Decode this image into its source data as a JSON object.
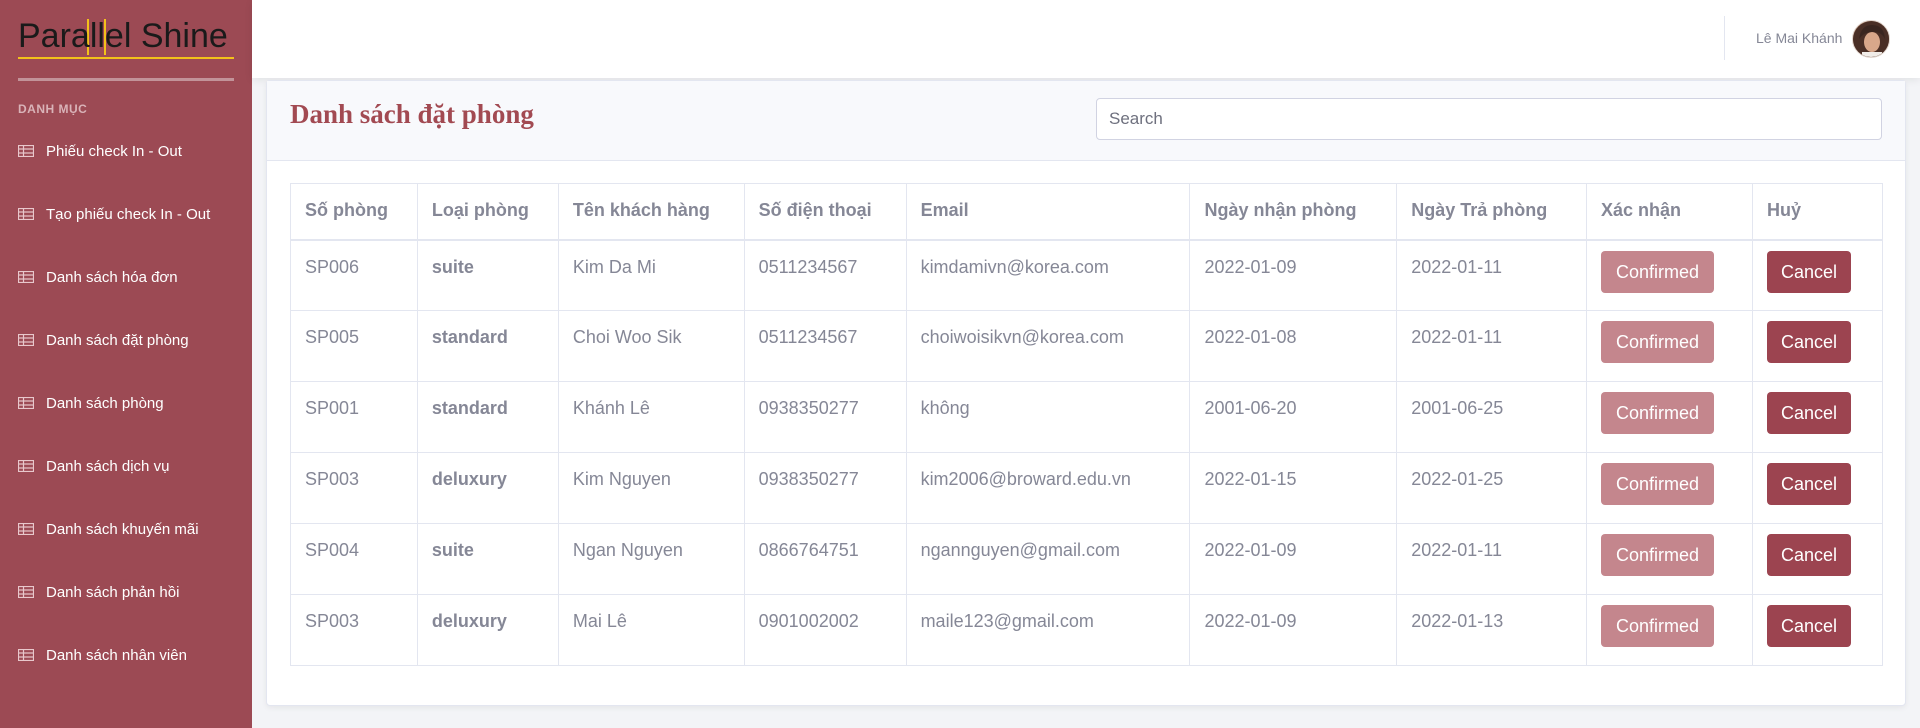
{
  "app": {
    "logo_text": "Parallel Shine",
    "colors": {
      "sidebar": "#9c4a54",
      "accent_title": "#a24a52",
      "logo_accent": "#f3c11a",
      "confirmed_button": "#c4868d",
      "cancel_button": "#9c4450"
    }
  },
  "sidebar": {
    "heading": "DANH MỤC",
    "items": [
      {
        "label": "Phiếu check In - Out",
        "icon": "table-icon"
      },
      {
        "label": "Tạo phiếu check In - Out",
        "icon": "table-icon"
      },
      {
        "label": "Danh sách hóa đơn",
        "icon": "table-icon"
      },
      {
        "label": "Danh sách đặt phòng",
        "icon": "table-icon"
      },
      {
        "label": "Danh sách phòng",
        "icon": "table-icon"
      },
      {
        "label": "Danh sách dịch vụ",
        "icon": "table-icon"
      },
      {
        "label": "Danh sách khuyến mãi",
        "icon": "table-icon"
      },
      {
        "label": "Danh sách phản hồi",
        "icon": "table-icon"
      },
      {
        "label": "Danh sách nhân viên",
        "icon": "table-icon"
      }
    ]
  },
  "topbar": {
    "user_name": "Lê Mai Khánh"
  },
  "main": {
    "title": "Danh sách đặt phòng",
    "search_placeholder": "Search",
    "table": {
      "headers": [
        "Số phòng",
        "Loại phòng",
        "Tên khách hàng",
        "Số điện thoại",
        "Email",
        "Ngày nhận phòng",
        "Ngày Trả phòng",
        "Xác nhận",
        "Huỷ"
      ],
      "rows": [
        {
          "room": "SP006",
          "type": "suite",
          "customer": "Kim Da Mi",
          "phone": "0511234567",
          "email": "kimdamivn@korea.com",
          "checkin": "2022-01-09",
          "checkout": "2022-01-11",
          "confirm": "Confirmed",
          "cancel": "Cancel"
        },
        {
          "room": "SP005",
          "type": "standard",
          "customer": "Choi Woo Sik",
          "phone": "0511234567",
          "email": "choiwoisikvn@korea.com",
          "checkin": "2022-01-08",
          "checkout": "2022-01-11",
          "confirm": "Confirmed",
          "cancel": "Cancel"
        },
        {
          "room": "SP001",
          "type": "standard",
          "customer": "Khánh Lê",
          "phone": "0938350277",
          "email": "không",
          "checkin": "2001-06-20",
          "checkout": "2001-06-25",
          "confirm": "Confirmed",
          "cancel": "Cancel"
        },
        {
          "room": "SP003",
          "type": "deluxury",
          "customer": "Kim Nguyen",
          "phone": "0938350277",
          "email": "kim2006@broward.edu.vn",
          "checkin": "2022-01-15",
          "checkout": "2022-01-25",
          "confirm": "Confirmed",
          "cancel": "Cancel"
        },
        {
          "room": "SP004",
          "type": "suite",
          "customer": "Ngan Nguyen",
          "phone": "0866764751",
          "email": "ngannguyen@gmail.com",
          "checkin": "2022-01-09",
          "checkout": "2022-01-11",
          "confirm": "Confirmed",
          "cancel": "Cancel"
        },
        {
          "room": "SP003",
          "type": "deluxury",
          "customer": "Mai Lê",
          "phone": "0901002002",
          "email": "maile123@gmail.com",
          "checkin": "2022-01-09",
          "checkout": "2022-01-13",
          "confirm": "Confirmed",
          "cancel": "Cancel"
        }
      ]
    }
  }
}
